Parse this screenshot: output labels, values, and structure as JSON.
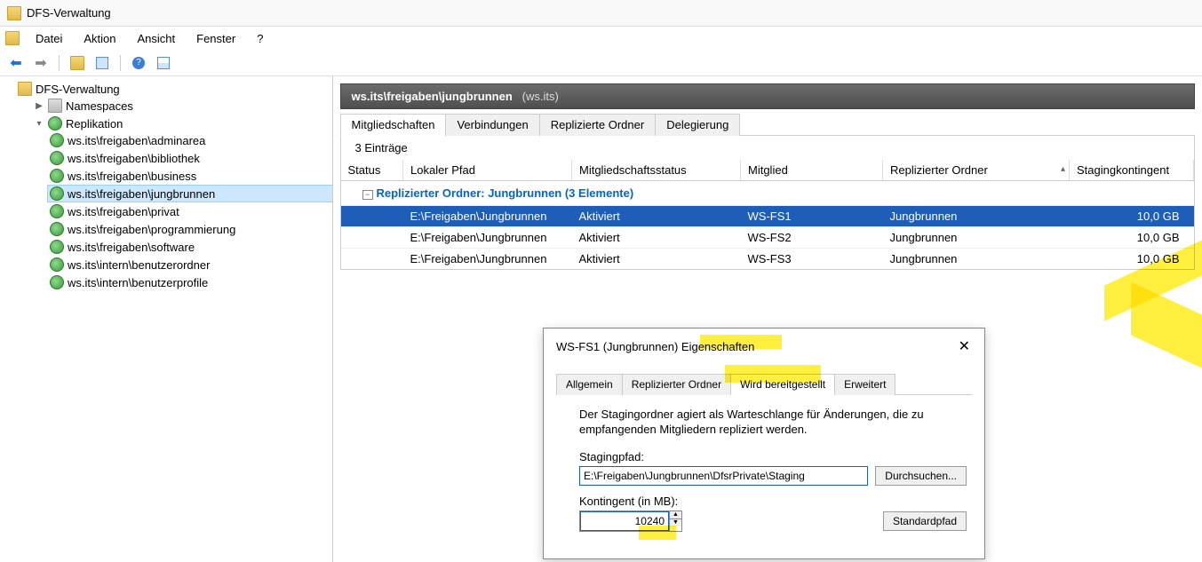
{
  "window": {
    "title": "DFS-Verwaltung"
  },
  "menu": {
    "items": [
      "Datei",
      "Aktion",
      "Ansicht",
      "Fenster",
      "?"
    ]
  },
  "tree": {
    "root": "DFS-Verwaltung",
    "namespaces": "Namespaces",
    "replication": "Replikation",
    "repl_items": [
      "ws.its\\freigaben\\adminarea",
      "ws.its\\freigaben\\bibliothek",
      "ws.its\\freigaben\\business",
      "ws.its\\freigaben\\jungbrunnen",
      "ws.its\\freigaben\\privat",
      "ws.its\\freigaben\\programmierung",
      "ws.its\\freigaben\\software",
      "ws.its\\intern\\benutzerordner",
      "ws.its\\intern\\benutzerprofile"
    ],
    "selected_index": 3
  },
  "header": {
    "path": "ws.its\\freigaben\\jungbrunnen",
    "domain": "(ws.its)"
  },
  "tabs": {
    "items": [
      "Mitgliedschaften",
      "Verbindungen",
      "Replizierte Ordner",
      "Delegierung"
    ],
    "active_index": 0
  },
  "entries_line": "3 Einträge",
  "columns": [
    "Status",
    "Lokaler Pfad",
    "Mitgliedschaftsstatus",
    "Mitglied",
    "Replizierter Ordner",
    "Stagingkontingent"
  ],
  "sort_col_index": 4,
  "group_label": "Replizierter Ordner: Jungbrunnen (3 Elemente)",
  "rows": [
    {
      "local_path": "E:\\Freigaben\\Jungbrunnen",
      "mstatus": "Aktiviert",
      "member": "WS-FS1",
      "rfolder": "Jungbrunnen",
      "staging": "10,0 GB",
      "selected": true
    },
    {
      "local_path": "E:\\Freigaben\\Jungbrunnen",
      "mstatus": "Aktiviert",
      "member": "WS-FS2",
      "rfolder": "Jungbrunnen",
      "staging": "10,0 GB",
      "selected": false
    },
    {
      "local_path": "E:\\Freigaben\\Jungbrunnen",
      "mstatus": "Aktiviert",
      "member": "WS-FS3",
      "rfolder": "Jungbrunnen",
      "staging": "10,0 GB",
      "selected": false
    }
  ],
  "dialog": {
    "title_prefix": "WS-FS1 (Jungbrunnen) ",
    "title_hl": "Eigenschaften",
    "tabs": [
      "Allgemein",
      "Replizierter Ordner",
      "Wird bereitgestellt",
      "Erweitert"
    ],
    "active_tab_index": 2,
    "desc": "Der Stagingordner agiert als Warteschlange für Änderungen, die zu empfangenden Mitgliedern repliziert werden.",
    "path_label": "Stagingpfad:",
    "path_value": "E:\\Freigaben\\Jungbrunnen\\DfsrPrivate\\Staging",
    "browse": "Durchsuchen...",
    "quota_label": "Kontingent (in MB):",
    "quota_value": "10240",
    "default_btn": "Standardpfad"
  }
}
